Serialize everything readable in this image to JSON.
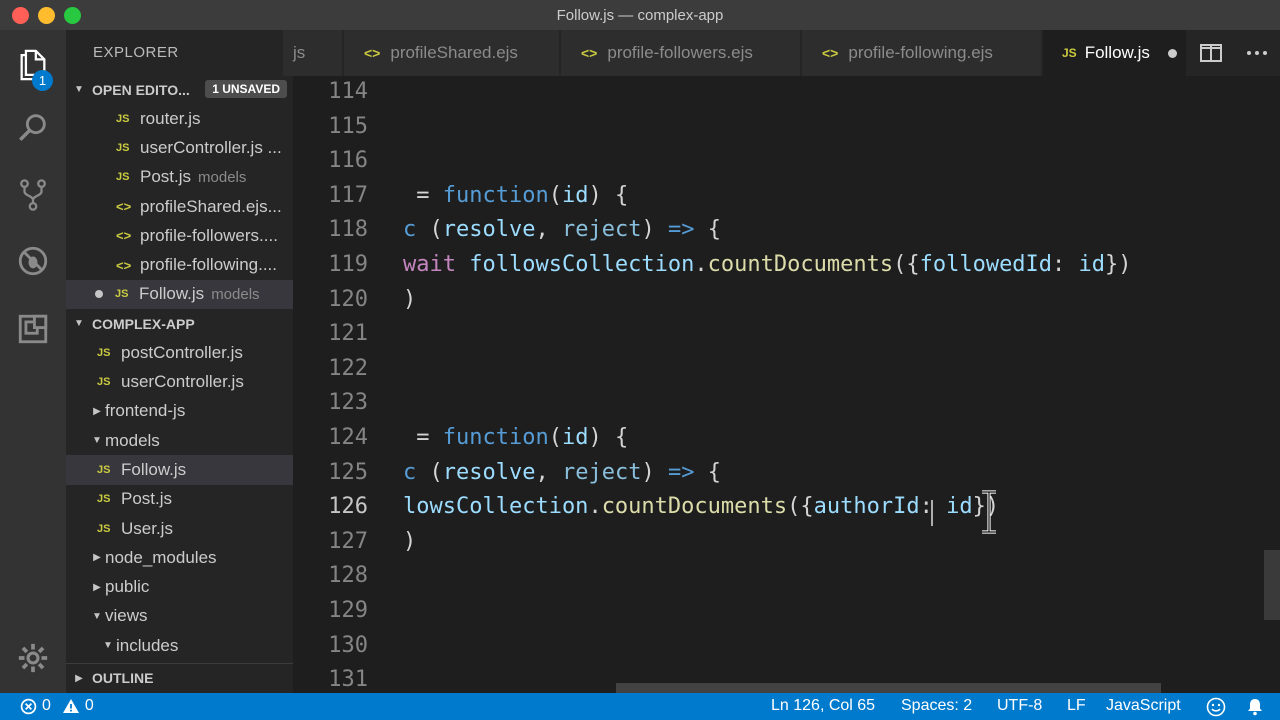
{
  "window": {
    "title": "Follow.js — complex-app"
  },
  "activity": {
    "explorer_badge": "1"
  },
  "sidebar": {
    "title": "EXPLORER",
    "open_editors": {
      "label": "OPEN EDITO...",
      "badge": "1 UNSAVED",
      "items": [
        {
          "icon": "JS",
          "name": "router.js",
          "desc": ""
        },
        {
          "icon": "JS",
          "name": "userController.js ...",
          "desc": ""
        },
        {
          "icon": "JS",
          "name": "Post.js",
          "desc": "models"
        },
        {
          "icon": "<>",
          "name": "profileShared.ejs...",
          "desc": ""
        },
        {
          "icon": "<>",
          "name": "profile-followers....",
          "desc": ""
        },
        {
          "icon": "<>",
          "name": "profile-following....",
          "desc": ""
        },
        {
          "icon": "JS",
          "name": "Follow.js",
          "desc": "models"
        }
      ]
    },
    "project": {
      "label": "COMPLEX-APP",
      "items": [
        {
          "kind": "file",
          "icon": "JS",
          "name": "postController.js"
        },
        {
          "kind": "file",
          "icon": "JS",
          "name": "userController.js"
        },
        {
          "kind": "folder",
          "caret": "▶",
          "name": "frontend-js"
        },
        {
          "kind": "folder",
          "caret": "▼",
          "name": "models"
        },
        {
          "kind": "file",
          "icon": "JS",
          "name": "Follow.js"
        },
        {
          "kind": "file",
          "icon": "JS",
          "name": "Post.js"
        },
        {
          "kind": "file",
          "icon": "JS",
          "name": "User.js"
        },
        {
          "kind": "folder",
          "caret": "▶",
          "name": "node_modules"
        },
        {
          "kind": "folder",
          "caret": "▶",
          "name": "public"
        },
        {
          "kind": "folder",
          "caret": "▼",
          "name": "views"
        },
        {
          "kind": "folder",
          "caret": "▼",
          "name": "includes"
        }
      ]
    },
    "outline": {
      "label": "OUTLINE"
    }
  },
  "tabs": [
    {
      "icon": "",
      "label": "js"
    },
    {
      "icon": "<>",
      "label": "profileShared.ejs"
    },
    {
      "icon": "<>",
      "label": "profile-followers.ejs"
    },
    {
      "icon": "<>",
      "label": "profile-following.ejs"
    },
    {
      "icon": "JS",
      "label": "Follow.js"
    }
  ],
  "editor": {
    "current_line": "126",
    "lines": [
      {
        "n": "114",
        "tokens": []
      },
      {
        "n": "115",
        "tokens": []
      },
      {
        "n": "116",
        "tokens": []
      },
      {
        "n": "117",
        "tokens": [
          {
            "t": " = ",
            "c": ""
          },
          {
            "t": "function",
            "c": "kw"
          },
          {
            "t": "(",
            "c": ""
          },
          {
            "t": "id",
            "c": "prm"
          },
          {
            "t": ") {",
            "c": ""
          }
        ]
      },
      {
        "n": "118",
        "tokens": [
          {
            "t": "c",
            "c": "kw"
          },
          {
            "t": " (",
            "c": ""
          },
          {
            "t": "resolve",
            "c": "prm"
          },
          {
            "t": ", ",
            "c": ""
          },
          {
            "t": "reject",
            "c": "rej"
          },
          {
            "t": ") ",
            "c": ""
          },
          {
            "t": "=>",
            "c": "op"
          },
          {
            "t": " {",
            "c": ""
          }
        ]
      },
      {
        "n": "119",
        "tokens": [
          {
            "t": "wait",
            "c": "ctl"
          },
          {
            "t": " ",
            "c": ""
          },
          {
            "t": "followsCollection",
            "c": "var"
          },
          {
            "t": ".",
            "c": ""
          },
          {
            "t": "countDocuments",
            "c": "fn"
          },
          {
            "t": "({",
            "c": ""
          },
          {
            "t": "followedId",
            "c": "var"
          },
          {
            "t": ": ",
            "c": ""
          },
          {
            "t": "id",
            "c": "prm"
          },
          {
            "t": "})",
            "c": ""
          }
        ]
      },
      {
        "n": "120",
        "tokens": [
          {
            "t": ")",
            "c": ""
          }
        ]
      },
      {
        "n": "121",
        "tokens": []
      },
      {
        "n": "122",
        "tokens": []
      },
      {
        "n": "123",
        "tokens": []
      },
      {
        "n": "124",
        "tokens": [
          {
            "t": " = ",
            "c": ""
          },
          {
            "t": "function",
            "c": "kw"
          },
          {
            "t": "(",
            "c": ""
          },
          {
            "t": "id",
            "c": "prm"
          },
          {
            "t": ") {",
            "c": ""
          }
        ]
      },
      {
        "n": "125",
        "tokens": [
          {
            "t": "c",
            "c": "kw"
          },
          {
            "t": " (",
            "c": ""
          },
          {
            "t": "resolve",
            "c": "prm"
          },
          {
            "t": ", ",
            "c": ""
          },
          {
            "t": "reject",
            "c": "rej"
          },
          {
            "t": ") ",
            "c": ""
          },
          {
            "t": "=>",
            "c": "op"
          },
          {
            "t": " {",
            "c": ""
          }
        ]
      },
      {
        "n": "126",
        "tokens": [
          {
            "t": "lowsCollection",
            "c": "var"
          },
          {
            "t": ".",
            "c": ""
          },
          {
            "t": "countDocuments",
            "c": "fn"
          },
          {
            "t": "({",
            "c": ""
          },
          {
            "t": "authorId",
            "c": "var"
          },
          {
            "t": ": ",
            "c": ""
          },
          {
            "t": "id",
            "c": "prm"
          },
          {
            "t": "})",
            "c": ""
          }
        ]
      },
      {
        "n": "127",
        "tokens": [
          {
            "t": ")",
            "c": ""
          }
        ]
      },
      {
        "n": "128",
        "tokens": []
      },
      {
        "n": "129",
        "tokens": []
      },
      {
        "n": "130",
        "tokens": []
      },
      {
        "n": "131",
        "tokens": []
      }
    ]
  },
  "status": {
    "errors": "0",
    "warnings": "0",
    "position": "Ln 126, Col 65",
    "spaces": "Spaces: 2",
    "encoding": "UTF-8",
    "eol": "LF",
    "language": "JavaScript"
  },
  "colors": {
    "accent": "#007acc",
    "js_icon": "#cbcb41"
  }
}
